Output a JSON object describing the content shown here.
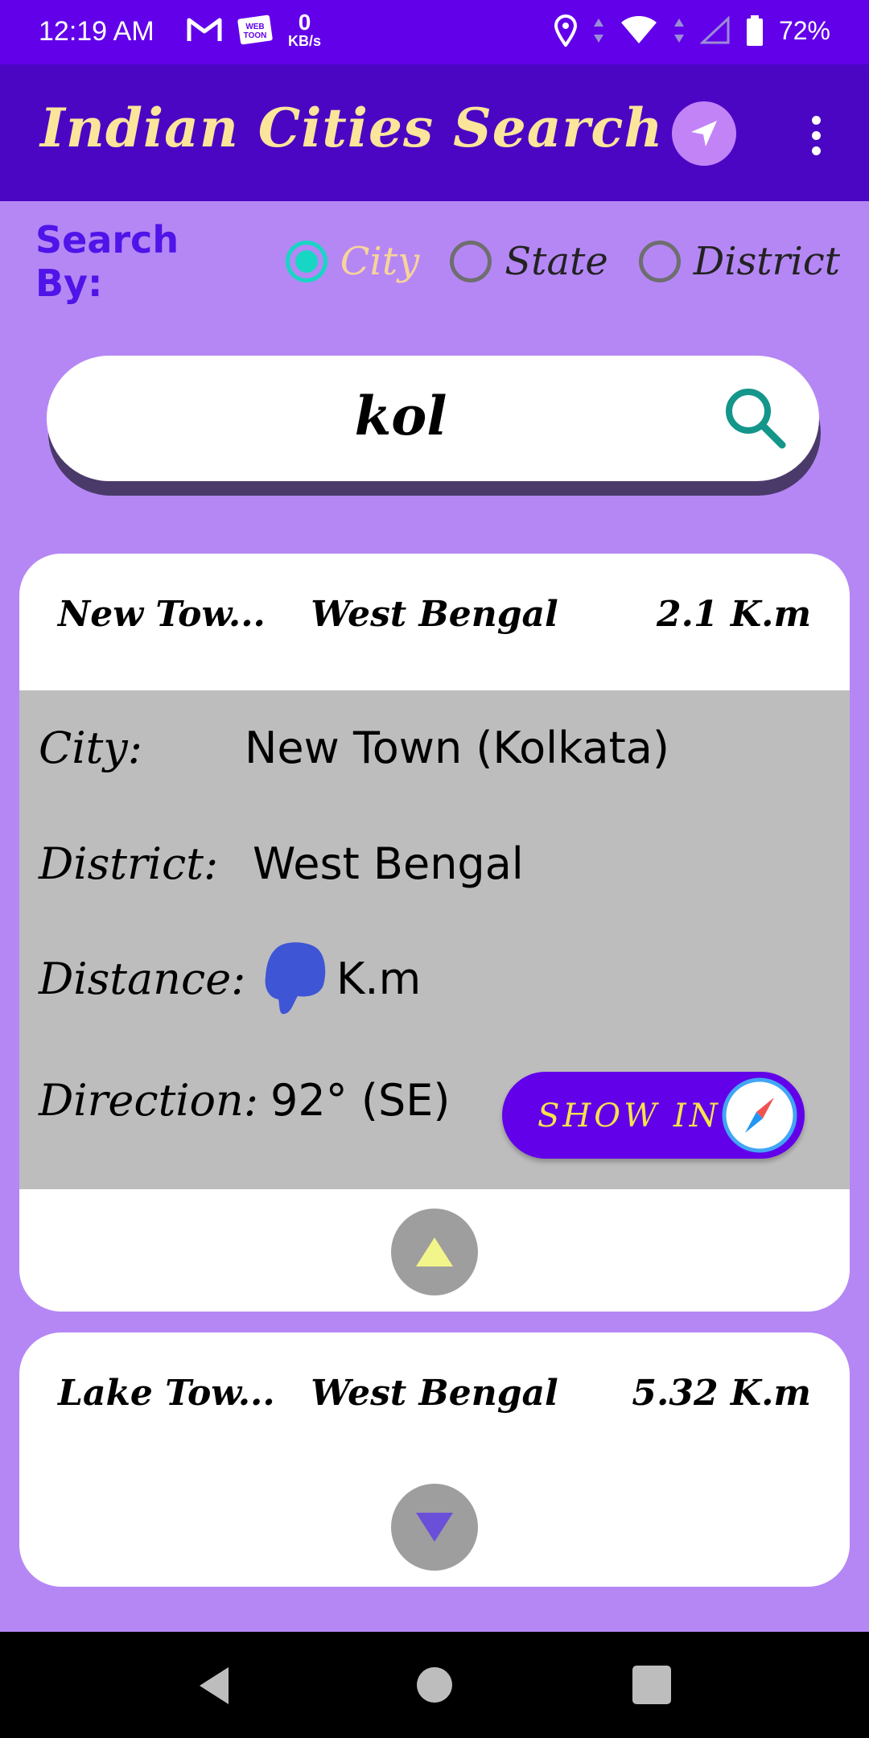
{
  "status_bar": {
    "time": "12:19 AM",
    "speed_value": "0",
    "speed_unit": "KB/s",
    "battery": "72%",
    "icons": [
      "gmail-icon",
      "webtoon-icon",
      "location-icon",
      "wifi-icon",
      "signal-icon",
      "battery-icon"
    ]
  },
  "app_bar": {
    "title": "Indian Cities Search",
    "nav_icon": "navigation-arrow-icon",
    "menu_icon": "more-vert-icon"
  },
  "search_by": {
    "label": "Search By:",
    "options": [
      {
        "label": "City",
        "checked": true
      },
      {
        "label": "State",
        "checked": false
      },
      {
        "label": "District",
        "checked": false
      }
    ]
  },
  "search": {
    "value": "kol",
    "icon": "search-icon"
  },
  "results": [
    {
      "city_short": "New Tow...",
      "state": "West Bengal",
      "distance": "2.1 K.m",
      "expanded": true,
      "details": {
        "city_label": "City:",
        "city_value": "New Town (Kolkata)",
        "district_label": "District:",
        "district_value": "West Bengal",
        "distance_label": "Distance:",
        "distance_unit": "K.m",
        "direction_label": "Direction:",
        "direction_value": "92° (SE)",
        "show_in_label": "SHOW IN"
      }
    },
    {
      "city_short": "Lake Tow...",
      "state": "West Bengal",
      "distance": "5.32 K.m",
      "expanded": false
    }
  ],
  "colors": {
    "status_bar": "#6200ea",
    "app_bar": "#4b06c4",
    "background": "#b587f5",
    "title": "#fbe59a",
    "accent_teal": "#18d6c4",
    "search_by": "#4f14e8"
  }
}
